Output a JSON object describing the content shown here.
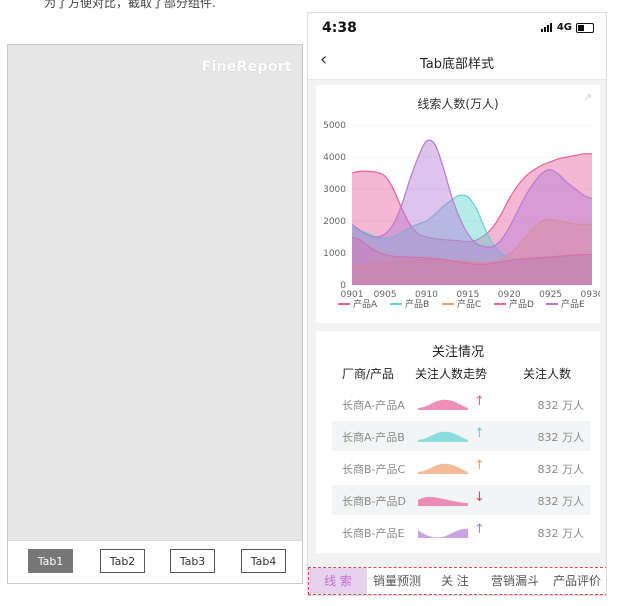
{
  "caption": "为了方便对比，截取了部分组件.",
  "designer": {
    "logo": "FineReport",
    "tabs": [
      "Tab1",
      "Tab2",
      "Tab3",
      "Tab4"
    ],
    "active_tab": 0
  },
  "phone": {
    "time": "4:38",
    "network": "4G",
    "nav_title": "Tab底部样式",
    "back_icon": "chevron-left-icon",
    "bottom_tabs": [
      "线 索",
      "销量预测",
      "关 注",
      "营销漏斗",
      "产品评价"
    ],
    "active_bottom_tab": 0
  },
  "chart_data": {
    "type": "area",
    "title": "线索人数(万人)",
    "x": [
      "0901",
      "0902",
      "0903",
      "0904",
      "0905",
      "0906",
      "0907",
      "0908",
      "0909",
      "0910",
      "0911",
      "0912",
      "0913",
      "0914",
      "0915",
      "0916",
      "0917",
      "0918",
      "0919",
      "0920",
      "0921",
      "0922",
      "0923",
      "0924",
      "0925",
      "0926",
      "0927",
      "0928",
      "0929",
      "0930"
    ],
    "xticks": [
      "0901",
      "0905",
      "0910",
      "0915",
      "0920",
      "0925",
      "0930"
    ],
    "yticks": [
      0,
      1000,
      2000,
      3000,
      4000,
      5000
    ],
    "ylim": [
      0,
      5000
    ],
    "legend_position": "bottom",
    "series": [
      {
        "name": "产品A",
        "color": "#e8609a",
        "values": [
          3500,
          3550,
          3550,
          3520,
          3400,
          3000,
          2400,
          1900,
          1600,
          1500,
          1450,
          1420,
          1400,
          1380,
          1350,
          1400,
          1550,
          1800,
          2200,
          2700,
          3100,
          3400,
          3600,
          3750,
          3850,
          3950,
          4000,
          4050,
          4100,
          4100
        ]
      },
      {
        "name": "产品B",
        "color": "#5ed3d1",
        "values": [
          1800,
          1700,
          1600,
          1500,
          1450,
          1500,
          1650,
          1800,
          1900,
          2000,
          2200,
          2450,
          2650,
          2800,
          2750,
          2400,
          1800,
          1300,
          1000,
          850,
          800,
          800,
          820,
          850,
          870,
          880,
          880,
          870,
          860,
          850
        ]
      },
      {
        "name": "产品C",
        "color": "#f0a06a",
        "values": [
          600,
          620,
          650,
          680,
          700,
          720,
          740,
          760,
          780,
          800,
          800,
          790,
          780,
          760,
          740,
          720,
          700,
          720,
          800,
          950,
          1200,
          1500,
          1800,
          2000,
          2050,
          2000,
          1950,
          1900,
          1900,
          1900
        ]
      },
      {
        "name": "产品D",
        "color": "#e86a8a",
        "values": [
          1500,
          1400,
          1200,
          1050,
          950,
          900,
          880,
          870,
          860,
          850,
          830,
          800,
          760,
          720,
          680,
          650,
          650,
          680,
          720,
          760,
          800,
          820,
          840,
          860,
          880,
          900,
          920,
          940,
          950,
          950
        ]
      },
      {
        "name": "产品E",
        "color": "#b57ad6",
        "values": [
          1900,
          1700,
          1550,
          1500,
          1600,
          1900,
          2500,
          3300,
          4000,
          4500,
          4400,
          3700,
          2800,
          2100,
          1600,
          1300,
          1200,
          1200,
          1400,
          1800,
          2300,
          2800,
          3200,
          3500,
          3600,
          3450,
          3200,
          3000,
          2800,
          2700
        ]
      }
    ]
  },
  "table": {
    "title": "关注情况",
    "headers": [
      "厂商/产品",
      "关注人数走势",
      "关注人数"
    ],
    "rows": [
      {
        "name": "长商A-产品A",
        "value": "832 万人",
        "color": "#e8609a",
        "trend": "up"
      },
      {
        "name": "长商A-产品B",
        "value": "832 万人",
        "color": "#5ed3d1",
        "trend": "up"
      },
      {
        "name": "长商B-产品C",
        "value": "832 万人",
        "color": "#f0a06a",
        "trend": "up"
      },
      {
        "name": "长商B-产品D",
        "value": "832 万人",
        "color": "#e8609a",
        "trend": "down"
      },
      {
        "name": "长商B-产品E",
        "value": "832 万人",
        "color": "#b57ad6",
        "trend": "up"
      }
    ],
    "arrows": {
      "up": "↑",
      "down": "↓"
    }
  }
}
